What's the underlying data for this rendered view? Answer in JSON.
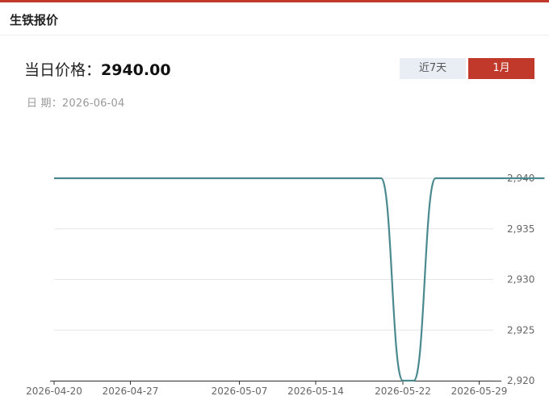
{
  "card": {
    "title": "生铁报价"
  },
  "price": {
    "label": "当日价格：",
    "value": "2940.00"
  },
  "date": {
    "text": "日 期：2026-06-04"
  },
  "range_tabs": [
    {
      "label": "近7天",
      "active": false
    },
    {
      "label": "1月",
      "active": true
    }
  ],
  "colors": {
    "accent": "#c0392b",
    "line": "#4a8a8f",
    "tab_inactive_bg": "#e9eef5"
  },
  "chart_data": {
    "type": "line",
    "title": "",
    "xlabel": "",
    "ylabel": "",
    "x_ticks": [
      "2026-04-20",
      "2026-04-27",
      "2026-05-07",
      "2026-05-14",
      "2026-05-22",
      "2026-05-29"
    ],
    "y_ticks": [
      "2,940",
      "2,935",
      "2,930",
      "2,925",
      "2,920"
    ],
    "ylim": [
      2920,
      2940
    ],
    "grid": true,
    "y_axis_side": "right",
    "series": [
      {
        "values": [
          [
            "2026-04-20",
            2940
          ],
          [
            "2026-05-20",
            2940
          ],
          [
            "2026-05-22",
            2920
          ],
          [
            "2026-05-23",
            2920
          ],
          [
            "2026-05-25",
            2940
          ],
          [
            "2026-06-04",
            2940
          ]
        ]
      }
    ]
  }
}
